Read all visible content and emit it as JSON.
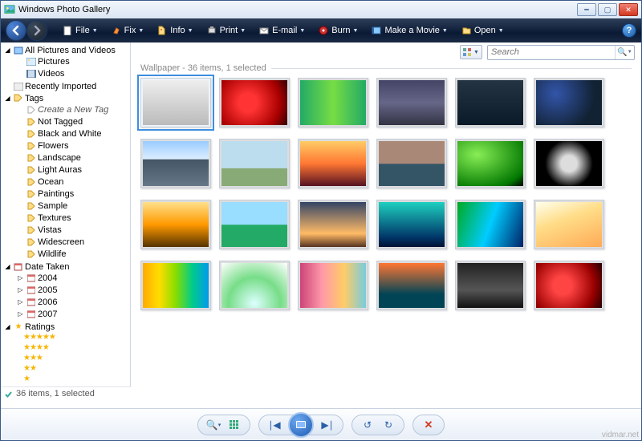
{
  "window": {
    "title": "Windows Photo Gallery"
  },
  "toolbar": {
    "items": [
      "File",
      "Fix",
      "Info",
      "Print",
      "E-mail",
      "Burn",
      "Make a Movie",
      "Open"
    ]
  },
  "search": {
    "placeholder": "Search"
  },
  "tree": {
    "root": "All Pictures and Videos",
    "pictures": "Pictures",
    "videos": "Videos",
    "recent": "Recently Imported",
    "tags": "Tags",
    "create_tag": "Create a New Tag",
    "tag_items": [
      "Not Tagged",
      "Black and White",
      "Flowers",
      "Landscape",
      "Light Auras",
      "Ocean",
      "Paintings",
      "Sample",
      "Textures",
      "Vistas",
      "Widescreen",
      "Wildlife"
    ],
    "date_taken": "Date Taken",
    "years": [
      "2004",
      "2005",
      "2006",
      "2007"
    ],
    "ratings": "Ratings"
  },
  "content": {
    "header": "Wallpaper - 36 items, 1 selected",
    "thumb_classes": [
      "g1",
      "g2",
      "g3",
      "g4",
      "g5",
      "g6",
      "g7",
      "g8",
      "g9",
      "g10",
      "g11",
      "g12",
      "g13",
      "g14",
      "g15",
      "g16",
      "g17",
      "g18",
      "g19",
      "g20",
      "g21",
      "g22",
      "g23",
      "g24"
    ]
  },
  "status": "36 items, 1 selected",
  "watermark": "vidmar.net"
}
